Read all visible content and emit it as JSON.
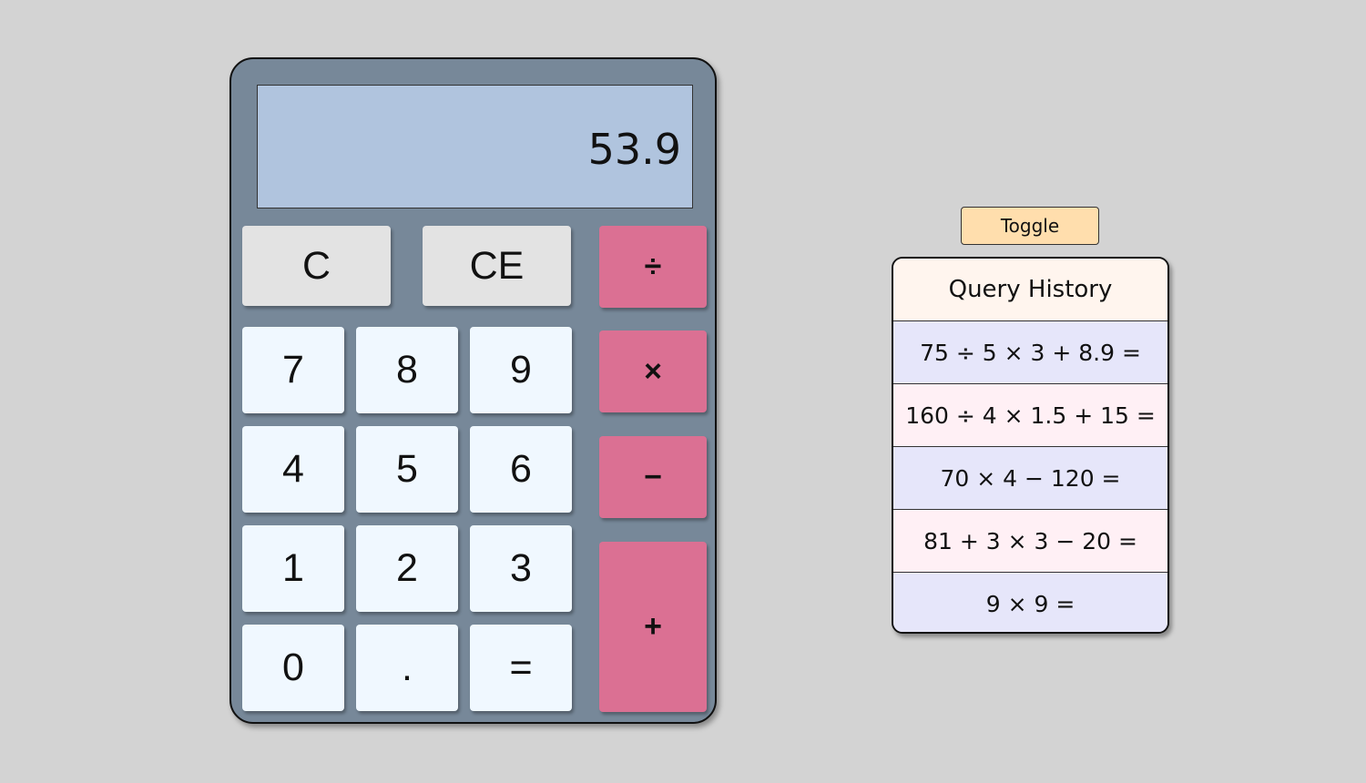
{
  "display": {
    "value": "53.9"
  },
  "keys": {
    "clear": "C",
    "clear_entry": "CE",
    "divide": "÷",
    "multiply": "×",
    "subtract": "−",
    "add": "+",
    "equals": "=",
    "decimal": ".",
    "digits": [
      "0",
      "1",
      "2",
      "3",
      "4",
      "5",
      "6",
      "7",
      "8",
      "9"
    ]
  },
  "toggle": {
    "label": "Toggle"
  },
  "history": {
    "title": "Query History",
    "items": [
      "75 ÷ 5 × 3 + 8.9 =",
      "160 ÷ 4 × 1.5 + 15 =",
      "70 × 4 − 120 =",
      "81 + 3 × 3 − 20 =",
      "9 × 9 ="
    ]
  },
  "colors": {
    "background": "#d3d3d3",
    "calculator_body": "#778899",
    "display": "#b0c4de",
    "function_key": "#e3e3e3",
    "number_key": "#f0f8ff",
    "operator_key": "#db7093",
    "toggle": "#ffdead",
    "history_title": "#fff5ee",
    "history_row_a": "#e6e6fa",
    "history_row_b": "#fff0f5"
  }
}
